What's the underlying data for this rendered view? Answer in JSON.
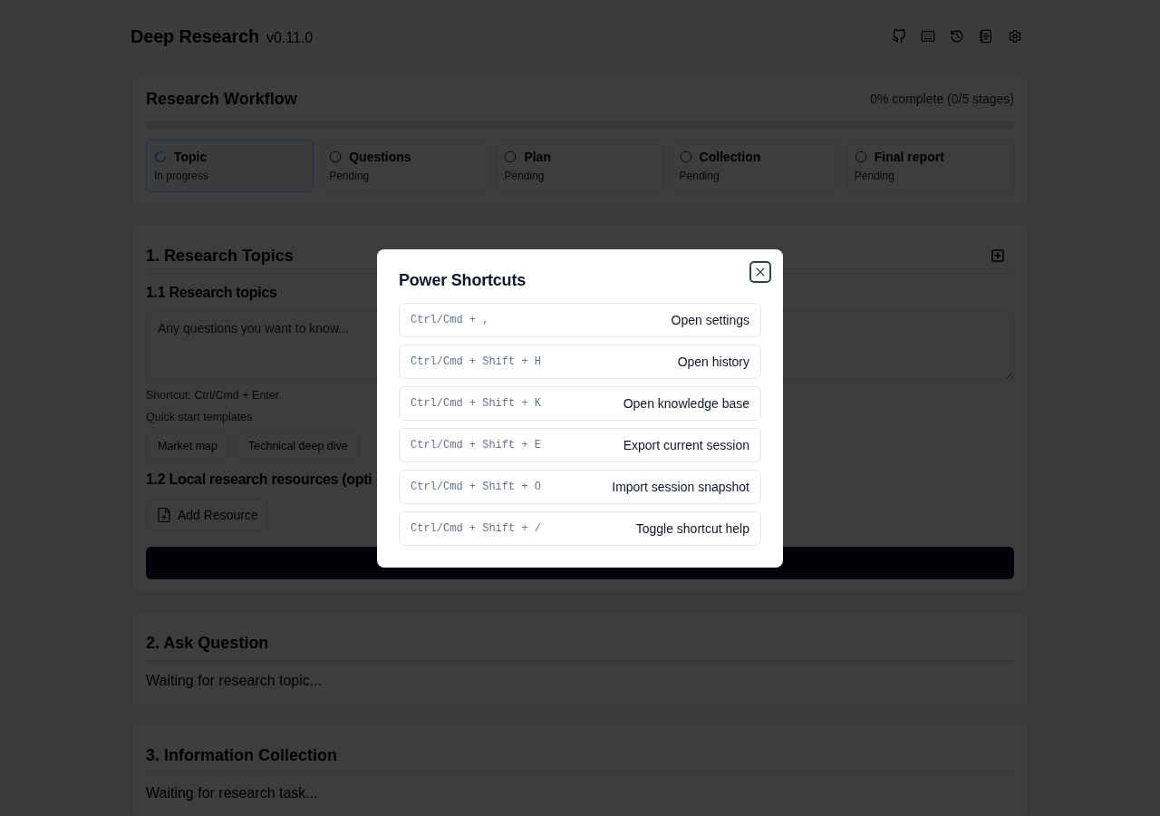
{
  "header": {
    "title": "Deep Research",
    "version": "v0.11.0"
  },
  "workflow": {
    "title": "Research Workflow",
    "summary": "0% complete (0/5 stages)",
    "level": 0,
    "stages": [
      {
        "name": "Topic",
        "status": "In progress",
        "active": true
      },
      {
        "name": "Questions",
        "status": "Pending",
        "active": false
      },
      {
        "name": "Plan",
        "status": "Pending",
        "active": false
      },
      {
        "name": "Collection",
        "status": "Pending",
        "active": false
      },
      {
        "name": "Final report",
        "status": "Pending",
        "active": false
      }
    ]
  },
  "topics": {
    "title": "1. Research Topics",
    "subtitle": "1.1 Research topics",
    "input": {
      "placeholder": "Any questions you want to know..."
    },
    "hint": "Shortcut: Ctrl/Cmd + Enter",
    "templates_label": "Quick start templates",
    "templates": [
      "Market map",
      "Technical deep dive"
    ],
    "resources_title": "1.2 Local research resources (opti",
    "add_resource": "Add Resource"
  },
  "sections": [
    {
      "title": "2. Ask Question",
      "text": "Waiting for research topic..."
    },
    {
      "title": "3. Information Collection",
      "text": "Waiting for research task..."
    }
  ],
  "dialog": {
    "title": "Power Shortcuts",
    "shortcuts": [
      {
        "keys": "Ctrl/Cmd + ,",
        "action": "Open settings"
      },
      {
        "keys": "Ctrl/Cmd + Shift + H",
        "action": "Open history"
      },
      {
        "keys": "Ctrl/Cmd + Shift + K",
        "action": "Open knowledge base"
      },
      {
        "keys": "Ctrl/Cmd + Shift + E",
        "action": "Export current session"
      },
      {
        "keys": "Ctrl/Cmd + Shift + O",
        "action": "Import session snapshot"
      },
      {
        "keys": "Ctrl/Cmd + Shift + /",
        "action": "Toggle shortcut help"
      }
    ]
  }
}
